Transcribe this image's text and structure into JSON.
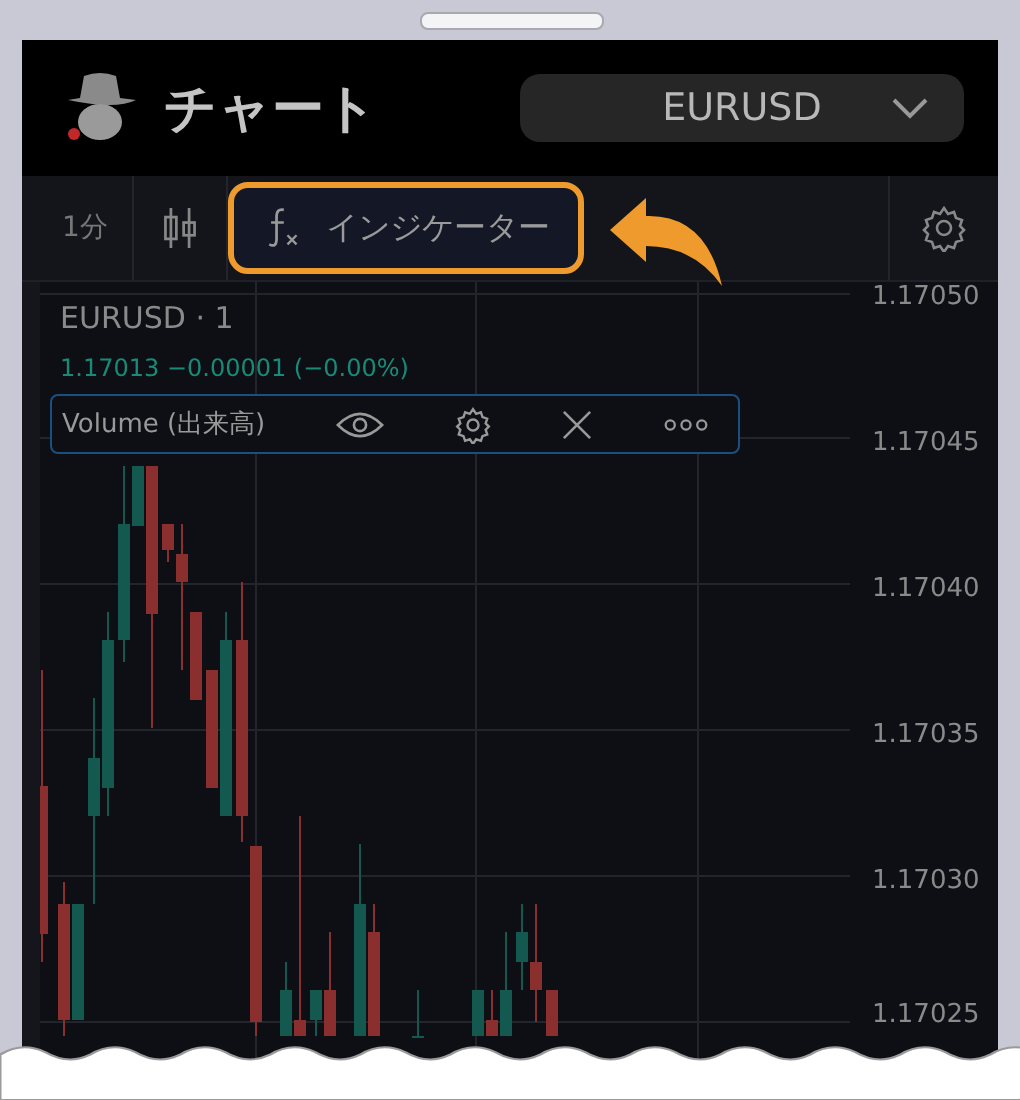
{
  "header": {
    "title": "チャート",
    "symbol_select": {
      "value": "EURUSD"
    }
  },
  "toolbar": {
    "interval": "1分",
    "indicator_button": {
      "label": "インジケーター",
      "highlighted": true
    }
  },
  "legend": {
    "symbol": "EURUSD · 1",
    "quote": "1.17013 −0.00001 (−0.00%)"
  },
  "indicator": {
    "name": "Volume (出来高)"
  },
  "price_axis": [
    "1.17050",
    "1.17045",
    "1.17040",
    "1.17035",
    "1.17030",
    "1.17025"
  ]
}
